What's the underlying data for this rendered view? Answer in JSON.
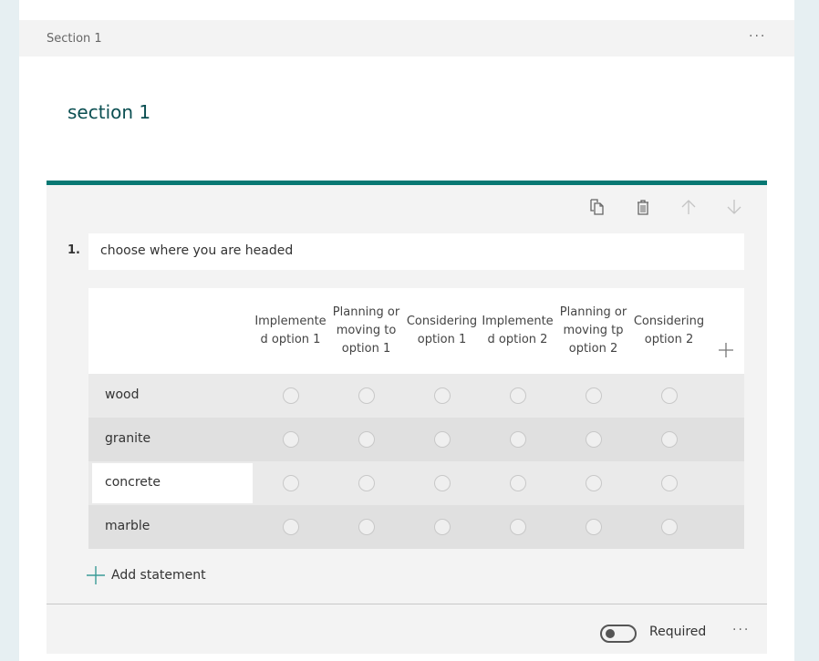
{
  "section_header": {
    "label": "Section 1",
    "more_label": "···"
  },
  "section_title": "section 1",
  "question": {
    "number": "1.",
    "title": "choose where you are headed",
    "toolbar": [
      {
        "name": "copy-question-button",
        "icon": "copy-icon",
        "enabled": true
      },
      {
        "name": "delete-question-button",
        "icon": "trash-icon",
        "enabled": true
      },
      {
        "name": "move-up-button",
        "icon": "arrow-up-icon",
        "enabled": false
      },
      {
        "name": "move-down-button",
        "icon": "arrow-down-icon",
        "enabled": false
      }
    ],
    "columns": [
      "Implemente d option 1",
      "Planning or moving to option 1",
      "Considering option 1",
      "Implemente d option 2",
      "Planning or moving tp option 2",
      "Considering option 2"
    ],
    "statements": [
      "wood",
      "granite",
      "concrete",
      "marble"
    ],
    "active_statement_index": 2,
    "add_statement_label": "Add statement",
    "required_label": "Required",
    "required": false,
    "more_label": "···"
  },
  "colors": {
    "accent": "#077873",
    "title": "#0b4f52"
  }
}
